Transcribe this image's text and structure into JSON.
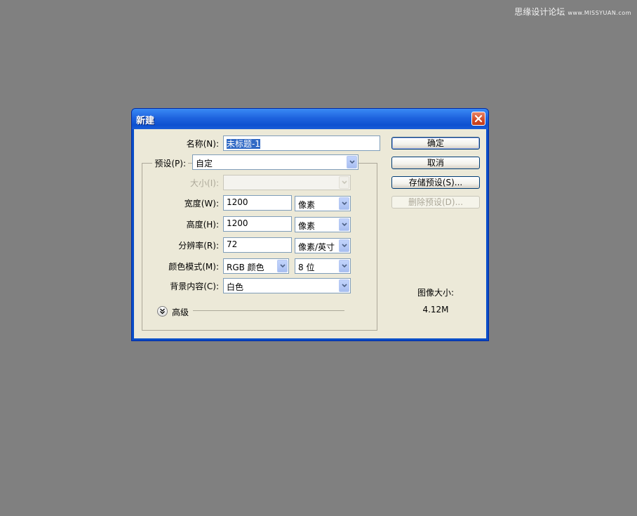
{
  "watermark": {
    "text": "思缘设计论坛",
    "url": "www.MISSYUAN.com"
  },
  "dialog": {
    "title": "新建",
    "close_icon": "close-icon",
    "name": {
      "label": "名称(N):",
      "value": "未标题-1"
    },
    "preset": {
      "label": "预设(P):",
      "value": "自定"
    },
    "size": {
      "label": "大小(I):",
      "value": ""
    },
    "width": {
      "label": "宽度(W):",
      "value": "1200",
      "unit": "像素"
    },
    "height": {
      "label": "高度(H):",
      "value": "1200",
      "unit": "像素"
    },
    "resolution": {
      "label": "分辨率(R):",
      "value": "72",
      "unit": "像素/英寸"
    },
    "color_mode": {
      "label": "颜色模式(M):",
      "mode": "RGB 颜色",
      "depth": "8 位"
    },
    "background": {
      "label": "背景内容(C):",
      "value": "白色"
    },
    "advanced": {
      "label": "高级",
      "icon": "chevron-double-down-icon"
    },
    "buttons": {
      "ok": "确定",
      "cancel": "取消",
      "save_preset": "存储预设(S)...",
      "delete_preset": "删除预设(D)..."
    },
    "image_size": {
      "label": "图像大小:",
      "value": "4.12M"
    }
  }
}
